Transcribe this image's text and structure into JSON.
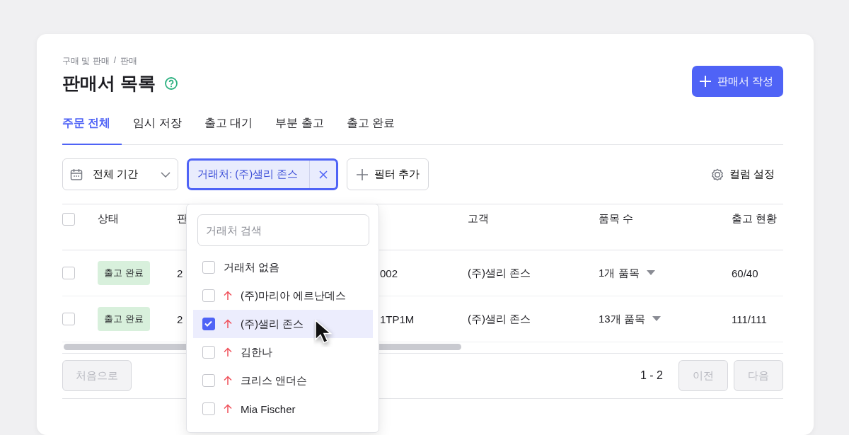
{
  "breadcrumb": {
    "items": [
      "구매 및 판매",
      "판매"
    ],
    "separator": "/"
  },
  "title": "판매서 목록",
  "create_button": {
    "label": "판매서 작성"
  },
  "tabs": [
    {
      "label": "주문 전체",
      "selected": true
    },
    {
      "label": "임시 저장",
      "selected": false
    },
    {
      "label": "출고 대기",
      "selected": false
    },
    {
      "label": "부분 출고",
      "selected": false
    },
    {
      "label": "출고 완료",
      "selected": false
    }
  ],
  "toolbar": {
    "date_filter": {
      "label": "전체 기간"
    },
    "active_filter": {
      "label": "거래처: (주)샐리 존스"
    },
    "add_filter_button": {
      "label": "필터 추가"
    },
    "column_settings_button": {
      "label": "컬럼 설정"
    }
  },
  "table": {
    "header_checkbox": {
      "checked": false
    },
    "columns": [
      {
        "kind": "badge",
        "label": "상태"
      },
      {
        "kind": "text",
        "label": "판"
      },
      {
        "kind": "text"
      },
      {
        "kind": "text",
        "label": "고객"
      },
      {
        "kind": "dropdown",
        "label": "품목 수"
      },
      {
        "kind": "text",
        "label": "출고 현황"
      }
    ],
    "rows": [
      {
        "checked": false,
        "cells": [
          "출고 완료",
          "2",
          "002",
          "(주)샐리 존스",
          "1개 품목",
          "60/40"
        ]
      },
      {
        "checked": false,
        "cells": [
          "출고 완료",
          "2",
          "1TP1M",
          "(주)샐리 존스",
          "13개 품목",
          "111/111"
        ]
      }
    ]
  },
  "pagination": {
    "first": {
      "label": "처음으로",
      "disabled": true
    },
    "range": "1 - 2",
    "prev": {
      "label": "이전",
      "disabled": true
    },
    "next": {
      "label": "다음",
      "disabled": true
    }
  },
  "dropdown": {
    "search": {
      "placeholder": "거래처 검색"
    },
    "options": [
      {
        "kind": "none",
        "label": "거래처 없음",
        "checked": false,
        "selected": false
      },
      {
        "kind": "company",
        "label": "(주)마리아 에르난데스",
        "checked": false,
        "selected": false
      },
      {
        "kind": "company",
        "label": "(주)샐리 존스",
        "checked": true,
        "selected": true
      },
      {
        "kind": "company",
        "label": "김한나",
        "checked": false,
        "selected": false
      },
      {
        "kind": "company",
        "label": "크리스 앤더슨",
        "checked": false,
        "selected": false
      },
      {
        "kind": "company",
        "label": "Mia Fischer",
        "checked": false,
        "selected": false
      }
    ]
  }
}
